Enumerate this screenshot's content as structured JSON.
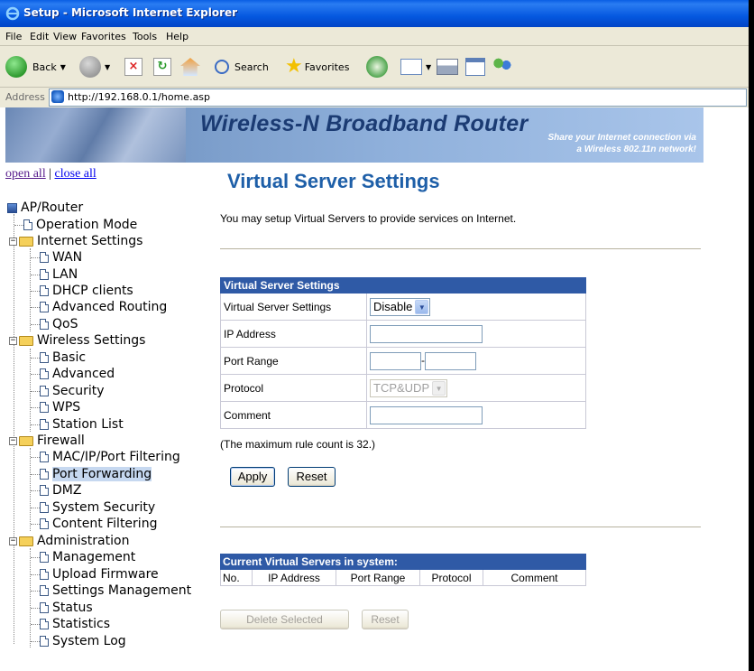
{
  "window": {
    "title": "Setup - Microsoft Internet Explorer"
  },
  "menu": [
    "File",
    "Edit",
    "View",
    "Favorites",
    "Tools",
    "Help"
  ],
  "toolbar": {
    "back": "Back",
    "search": "Search",
    "favorites": "Favorites"
  },
  "address": {
    "label": "Address",
    "url": "http://192.168.0.1/home.asp"
  },
  "banner": {
    "title": "Wireless-N Broadband Router",
    "tagline1": "Share your Internet connection via",
    "tagline2": "a Wireless 802.11n network!"
  },
  "tree_links": {
    "open_all": "open all",
    "separator": "|",
    "close_all": "close all"
  },
  "tree": {
    "root": "AP/Router",
    "operation_mode": "Operation Mode",
    "internet": {
      "label": "Internet Settings",
      "items": [
        "WAN",
        "LAN",
        "DHCP clients",
        "Advanced Routing",
        "QoS"
      ]
    },
    "wireless": {
      "label": "Wireless Settings",
      "items": [
        "Basic",
        "Advanced",
        "Security",
        "WPS",
        "Station List"
      ]
    },
    "firewall": {
      "label": "Firewall",
      "items": [
        "MAC/IP/Port Filtering",
        "Port Forwarding",
        "DMZ",
        "System Security",
        "Content Filtering"
      ]
    },
    "admin": {
      "label": "Administration",
      "items": [
        "Management",
        "Upload Firmware",
        "Settings Management",
        "Status",
        "Statistics",
        "System Log"
      ]
    }
  },
  "page": {
    "title": "Virtual Server Settings",
    "intro": "You may setup Virtual Servers to provide services on Internet.",
    "form": {
      "header": "Virtual Server Settings",
      "rows": {
        "enable_label": "Virtual Server Settings",
        "enable_value": "Disable",
        "ip_label": "IP Address",
        "port_label": "Port Range",
        "port_sep": "-",
        "protocol_label": "Protocol",
        "protocol_value": "TCP&UDP",
        "comment_label": "Comment"
      },
      "note": "(The maximum rule count is 32.)",
      "apply": "Apply",
      "reset": "Reset"
    },
    "current": {
      "header": "Current Virtual Servers in system:",
      "columns": [
        "No.",
        "IP Address",
        "Port Range",
        "Protocol",
        "Comment"
      ],
      "delete_selected": "Delete Selected",
      "reset": "Reset"
    }
  }
}
